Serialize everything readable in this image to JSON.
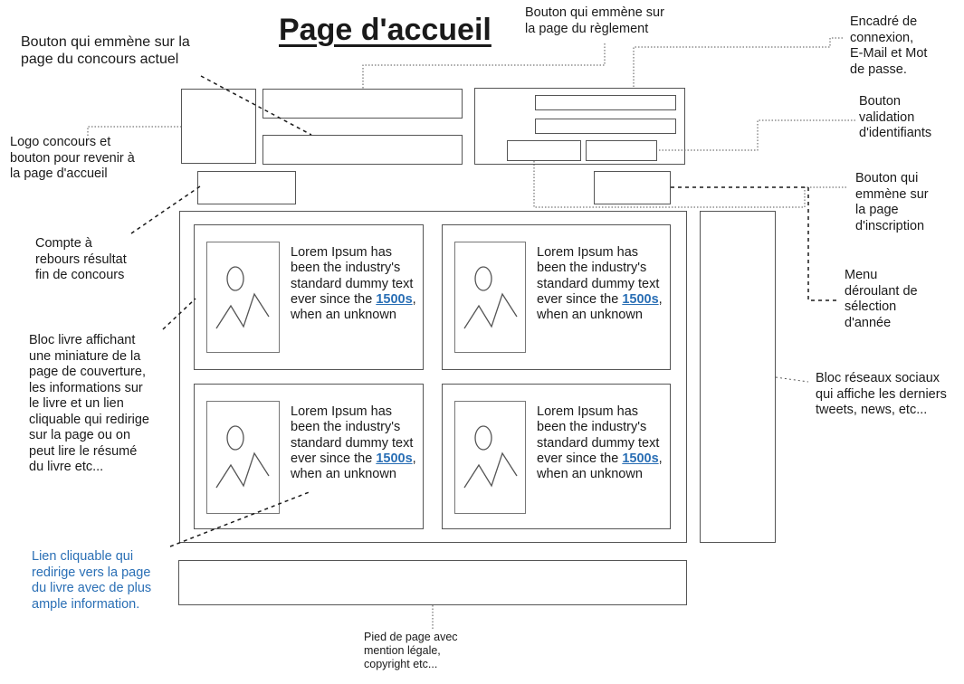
{
  "page": {
    "title": "Page d'accueil"
  },
  "annotations": {
    "contest_button": "Bouton qui emmène sur la\npage du concours actuel",
    "rules_button": "Bouton qui emmène sur\nla page du règlement",
    "login_box": "Encadré de\nconnexion,\nE-Mail et Mot\nde passe.",
    "validate_button": "Bouton\nvalidation\nd'identifiants",
    "logo": "Logo concours et\nbouton pour revenir à\nla page d'accueil",
    "signup_button": "Bouton qui\nemmène sur\nla page\nd'inscription",
    "countdown": "Compte à\nrebours résultat\nfin de concours",
    "year_menu": "Menu\ndéroulant de\nsélection\nd'année",
    "book_block": "Bloc livre affichant\nune miniature de la\npage de couverture,\nles informations sur\nle livre et un lien\ncliquable qui redirige\nsur la page ou on\npeut lire le résumé\ndu livre etc...",
    "social_block": "Bloc réseaux sociaux\nqui affiche les derniers\ntweets, news, etc...",
    "book_link": "Lien cliquable qui\nredirige vers la page\ndu livre avec de plus\nample information.",
    "footer": "Pied de page avec\nmention légale,\ncopyright etc...",
    "book_link_color": "#2a6fb5"
  },
  "books": [
    {
      "text_before": "Lorem Ipsum has been the industry's standard dummy text ever since the ",
      "link": "1500s",
      "text_after": ", when an unknown"
    },
    {
      "text_before": "Lorem Ipsum has been the industry's standard dummy text ever since the ",
      "link": "1500s",
      "text_after": ", when an unknown"
    },
    {
      "text_before": "Lorem Ipsum has been the industry's standard dummy text ever since the ",
      "link": "1500s",
      "text_after": ", when an unknown"
    },
    {
      "text_before": "Lorem Ipsum has been the industry's standard dummy text ever since the ",
      "link": "1500s",
      "text_after": ", when an unknown"
    }
  ]
}
